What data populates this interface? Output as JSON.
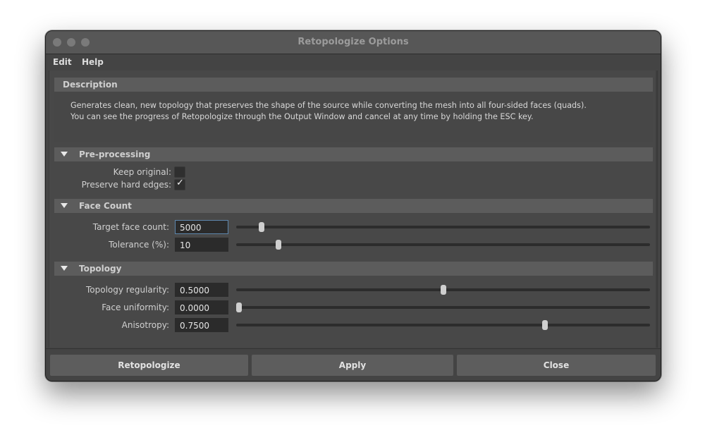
{
  "window": {
    "title": "Retopologize Options"
  },
  "menu": {
    "items": [
      "Edit",
      "Help"
    ]
  },
  "description": {
    "header": "Description",
    "lines": [
      "Generates clean, new topology that preserves the shape of the source while converting the mesh into all four-sided faces (quads).",
      "You can see the progress of Retopologize through the Output Window and cancel at any time by holding the ESC key."
    ]
  },
  "preprocessing": {
    "header": "Pre-processing",
    "keep_original": {
      "label": "Keep original:",
      "checked": false
    },
    "preserve_hard_edges": {
      "label": "Preserve hard edges:",
      "checked": true,
      "check_glyph": "✓"
    }
  },
  "face_count": {
    "header": "Face Count",
    "target_face_count": {
      "label": "Target face count:",
      "value": "5000",
      "slider_fraction": 0.056
    },
    "tolerance": {
      "label": "Tolerance (%):",
      "value": "10",
      "slider_fraction": 0.097
    }
  },
  "topology": {
    "header": "Topology",
    "topology_regularity": {
      "label": "Topology regularity:",
      "value": "0.5000",
      "slider_fraction": 0.5
    },
    "face_uniformity": {
      "label": "Face uniformity:",
      "value": "0.0000",
      "slider_fraction": 0.0
    },
    "anisotropy": {
      "label": "Anisotropy:",
      "value": "0.7500",
      "slider_fraction": 0.75
    }
  },
  "buttons": {
    "retopologize": "Retopologize",
    "apply": "Apply",
    "close": "Close"
  }
}
